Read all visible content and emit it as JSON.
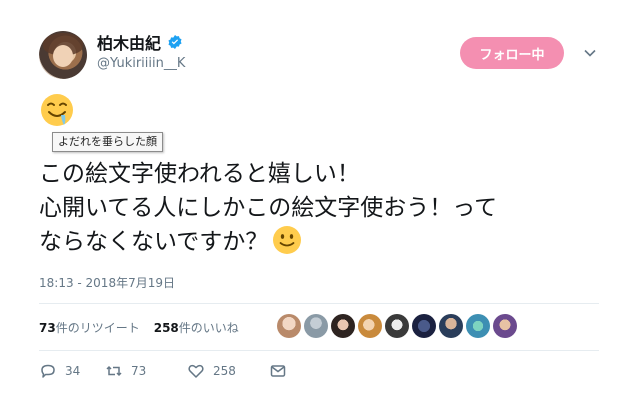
{
  "user": {
    "display_name": "柏木由紀",
    "handle": "@Yukiriiiin__K",
    "verified": true
  },
  "follow_button": {
    "label": "フォロー中",
    "color": "#f48fb1"
  },
  "tooltip": {
    "text": "よだれを垂らした顔"
  },
  "tweet": {
    "line1": "この絵文字使われると嬉しい！",
    "line2": "心開いてる人にしかこの絵文字使おう！って",
    "line3": "ならなくないですか？",
    "emoji_top": "drooling-face",
    "emoji_end": "slightly-smiling-face"
  },
  "timestamp": "18:13 - 2018年7月19日",
  "stats": {
    "retweets_count": "73",
    "retweets_label": "件のリツイート",
    "likes_count": "258",
    "likes_label": "件のいいね"
  },
  "actions": {
    "reply_count": "34",
    "retweet_count": "73",
    "like_count": "258"
  },
  "colors": {
    "text": "#14171a",
    "muted": "#657786",
    "verified": "#1da1f2",
    "divider": "#e6ecf0"
  }
}
